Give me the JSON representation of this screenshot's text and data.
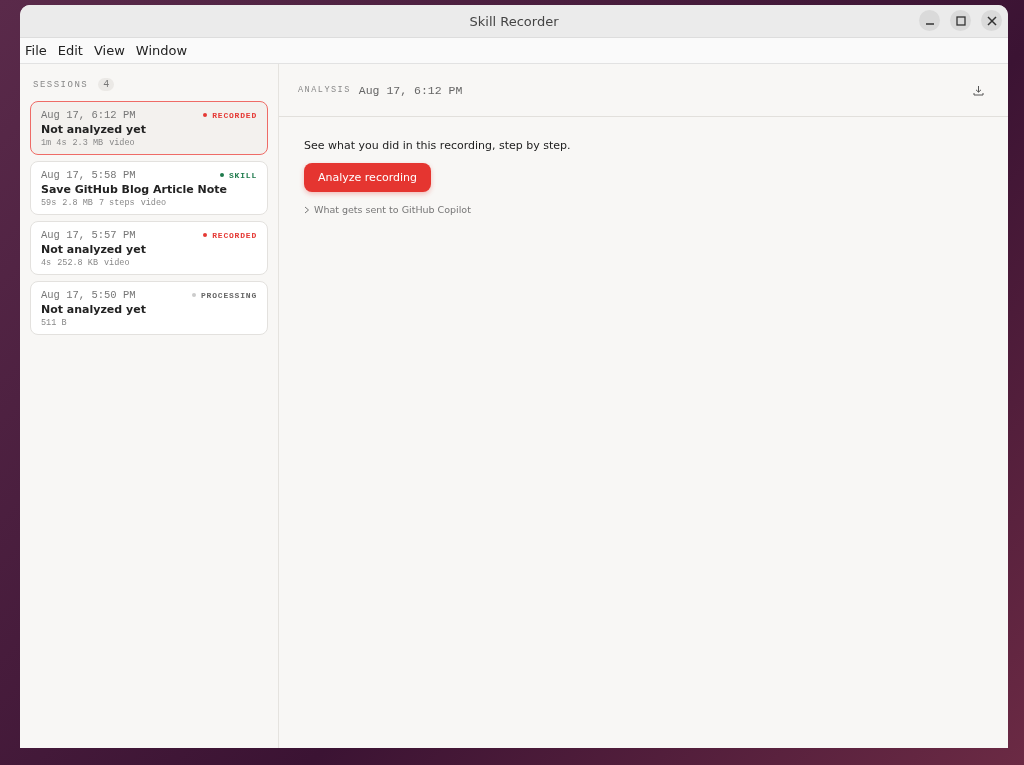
{
  "window": {
    "title": "Skill Recorder"
  },
  "menu": [
    "File",
    "Edit",
    "View",
    "Window"
  ],
  "sidebar": {
    "heading": "SESSIONS",
    "count": "4",
    "sessions": [
      {
        "time": "Aug 17, 6:12 PM",
        "status": "RECORDED",
        "color": "#e53935",
        "title": "Not analyzed yet",
        "meta": [
          "1m 4s",
          "2.3 MB",
          "video"
        ],
        "selected": true
      },
      {
        "time": "Aug 17, 5:58 PM",
        "status": "SKILL",
        "color": "#1e7a4c",
        "title": "Save GitHub Blog Article Note",
        "meta": [
          "59s",
          "2.8 MB",
          "7 steps",
          "video"
        ],
        "selected": false
      },
      {
        "time": "Aug 17, 5:57 PM",
        "status": "RECORDED",
        "color": "#e53935",
        "title": "Not analyzed yet",
        "meta": [
          "4s",
          "252.8 KB",
          "video"
        ],
        "selected": false
      },
      {
        "time": "Aug 17, 5:50 PM",
        "status": "PROCESSING",
        "color": "#cccccc",
        "title": "Not analyzed yet",
        "meta": [
          "511 B"
        ],
        "selected": false
      }
    ]
  },
  "main": {
    "label": "ANALYSIS",
    "time": "Aug 17, 6:12 PM",
    "description": "See what you did in this recording, step by step.",
    "button": "Analyze recording",
    "disclosure": "What gets sent to GitHub Copilot"
  }
}
